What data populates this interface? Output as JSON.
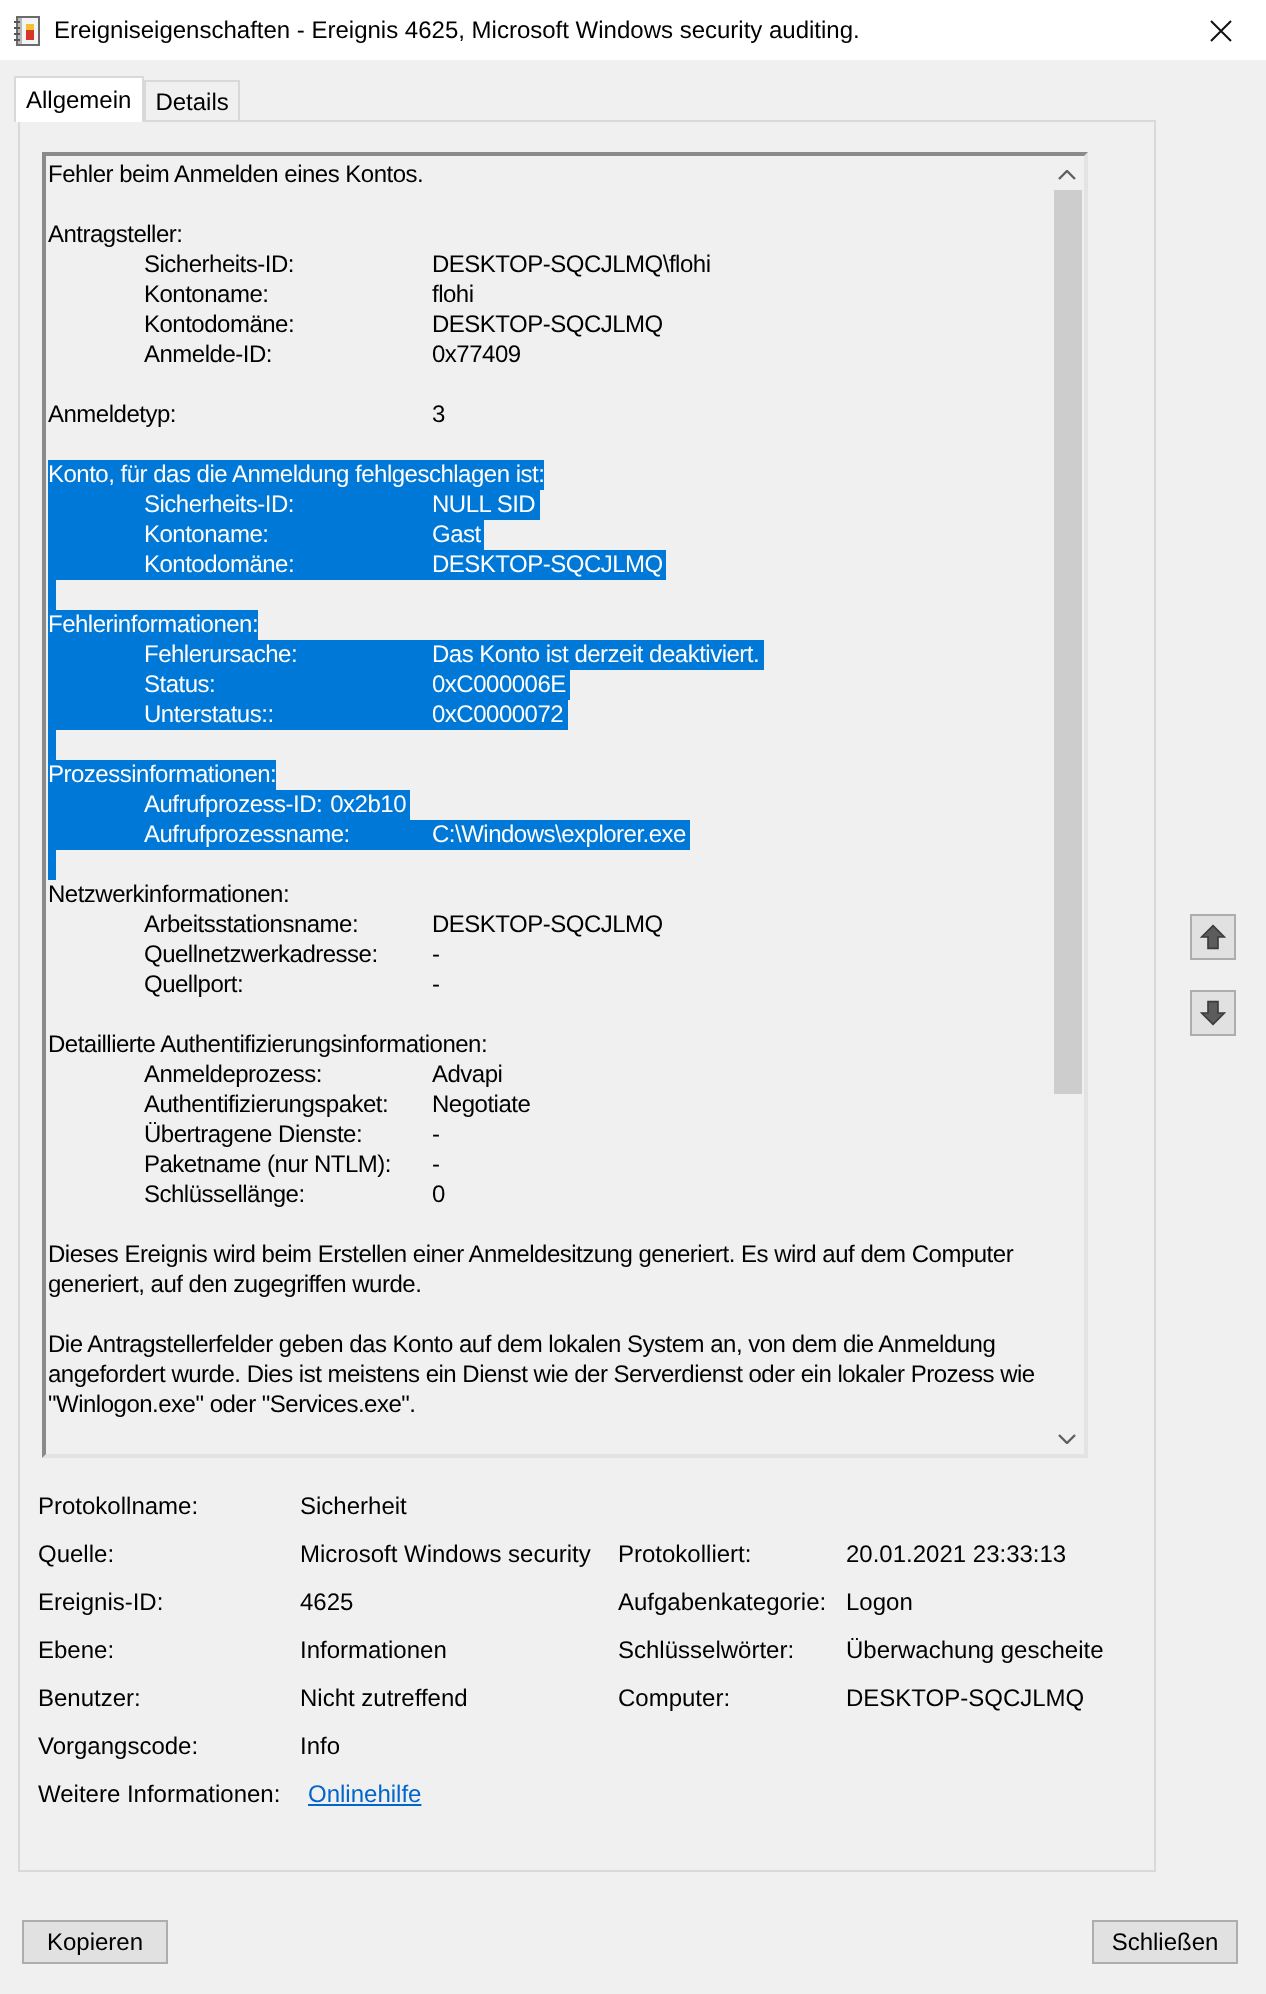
{
  "window": {
    "title": "Ereigniseigenschaften - Ereignis 4625, Microsoft Windows security auditing."
  },
  "tabs": [
    {
      "label": "Allgemein",
      "selected": true
    },
    {
      "label": "Details",
      "selected": false
    }
  ],
  "description": {
    "lines": [
      {
        "kind": "text",
        "text": "Fehler beim Anmelden eines Kontos.",
        "selected": false
      },
      {
        "kind": "blank",
        "selected": false
      },
      {
        "kind": "text",
        "text": "Antragsteller:",
        "selected": false
      },
      {
        "kind": "field",
        "label": "Sicherheits-ID:",
        "value": "DESKTOP-SQCJLMQ\\flohi",
        "selected": false
      },
      {
        "kind": "field",
        "label": "Kontoname:",
        "value": "flohi",
        "selected": false
      },
      {
        "kind": "field",
        "label": "Kontodomäne:",
        "value": "DESKTOP-SQCJLMQ",
        "selected": false
      },
      {
        "kind": "field",
        "label": "Anmelde-ID:",
        "value": "0x77409",
        "selected": false
      },
      {
        "kind": "blank",
        "selected": false
      },
      {
        "kind": "root_field",
        "label": "Anmeldetyp:",
        "value": "3",
        "selected": false
      },
      {
        "kind": "blank",
        "selected": false
      },
      {
        "kind": "text",
        "text": "Konto, für das die Anmeldung fehlgeschlagen ist:",
        "selected": true
      },
      {
        "kind": "field",
        "label": "Sicherheits-ID:",
        "value": "NULL SID",
        "selected": true
      },
      {
        "kind": "field",
        "label": "Kontoname:",
        "value": "Gast",
        "selected": true
      },
      {
        "kind": "field",
        "label": "Kontodomäne:",
        "value": "DESKTOP-SQCJLMQ",
        "selected": true
      },
      {
        "kind": "blank",
        "selected": true
      },
      {
        "kind": "text",
        "text": "Fehlerinformationen:",
        "selected": true
      },
      {
        "kind": "field",
        "label": "Fehlerursache:",
        "value": "Das Konto ist derzeit deaktiviert.",
        "selected": true
      },
      {
        "kind": "field",
        "label": "Status:",
        "value": "0xC000006E",
        "selected": true
      },
      {
        "kind": "field",
        "label": "Unterstatus::",
        "value": "0xC0000072",
        "selected": true
      },
      {
        "kind": "blank",
        "selected": true
      },
      {
        "kind": "text",
        "text": "Prozessinformationen:",
        "selected": true
      },
      {
        "kind": "field_inline",
        "label": "Aufrufprozess-ID:",
        "value": "0x2b10",
        "selected": true
      },
      {
        "kind": "field",
        "label": "Aufrufprozessname:",
        "value": "C:\\Windows\\explorer.exe",
        "selected": true
      },
      {
        "kind": "blank",
        "selected": true
      },
      {
        "kind": "text",
        "text": "Netzwerkinformationen:",
        "selected": false
      },
      {
        "kind": "field",
        "label": "Arbeitsstationsname:",
        "value": "DESKTOP-SQCJLMQ",
        "selected": false
      },
      {
        "kind": "field",
        "label": "Quellnetzwerkadresse:",
        "value": "-",
        "selected": false
      },
      {
        "kind": "field",
        "label": "Quellport:",
        "value": "-",
        "selected": false
      },
      {
        "kind": "blank",
        "selected": false
      },
      {
        "kind": "text",
        "text": "Detaillierte Authentifizierungsinformationen:",
        "selected": false
      },
      {
        "kind": "field",
        "label": "Anmeldeprozess:",
        "value": "Advapi",
        "selected": false
      },
      {
        "kind": "field",
        "label": "Authentifizierungspaket:",
        "value": "Negotiate",
        "selected": false
      },
      {
        "kind": "field",
        "label": "Übertragene Dienste:",
        "value": "-",
        "selected": false
      },
      {
        "kind": "field",
        "label": "Paketname (nur NTLM):",
        "value": "-",
        "selected": false
      },
      {
        "kind": "field",
        "label": "Schlüssellänge:",
        "value": "0",
        "selected": false
      },
      {
        "kind": "blank",
        "selected": false
      },
      {
        "kind": "text",
        "text": "Dieses Ereignis wird beim Erstellen einer Anmeldesitzung generiert. Es wird auf dem Computer generiert, auf den zugegriffen wurde.",
        "selected": false
      },
      {
        "kind": "blank",
        "selected": false
      },
      {
        "kind": "text",
        "text": "Die Antragstellerfelder geben das Konto auf dem lokalen System an, von dem die Anmeldung angefordert wurde. Dies ist meistens ein Dienst wie der Serverdienst oder ein lokaler Prozess wie \"Winlogon.exe\" oder \"Services.exe\".",
        "selected": false
      }
    ]
  },
  "properties": [
    {
      "items": [
        {
          "kind": "text",
          "label": "Protokollname:",
          "value": "Sicherheit"
        }
      ]
    },
    {
      "items": [
        {
          "kind": "text",
          "label": "Quelle:",
          "value": "Microsoft Windows security"
        },
        {
          "kind": "text",
          "label": "Protokolliert:",
          "value": "20.01.2021 23:33:13"
        }
      ]
    },
    {
      "items": [
        {
          "kind": "text",
          "label": "Ereignis-ID:",
          "value": "4625"
        },
        {
          "kind": "text",
          "label": "Aufgabenkategorie:",
          "value": "Logon"
        }
      ]
    },
    {
      "items": [
        {
          "kind": "text",
          "label": "Ebene:",
          "value": "Informationen"
        },
        {
          "kind": "text",
          "label": "Schlüsselwörter:",
          "value": "Überwachung gescheite"
        }
      ]
    },
    {
      "items": [
        {
          "kind": "text",
          "label": "Benutzer:",
          "value": "Nicht zutreffend"
        },
        {
          "kind": "text",
          "label": "Computer:",
          "value": "DESKTOP-SQCJLMQ"
        }
      ]
    },
    {
      "items": [
        {
          "kind": "text",
          "label": "Vorgangscode:",
          "value": "Info"
        }
      ]
    },
    {
      "items": [
        {
          "kind": "link",
          "label": "Weitere Informationen:",
          "value": "Onlinehilfe"
        }
      ]
    }
  ],
  "buttons": [
    "Kopieren",
    "Schließen"
  ]
}
